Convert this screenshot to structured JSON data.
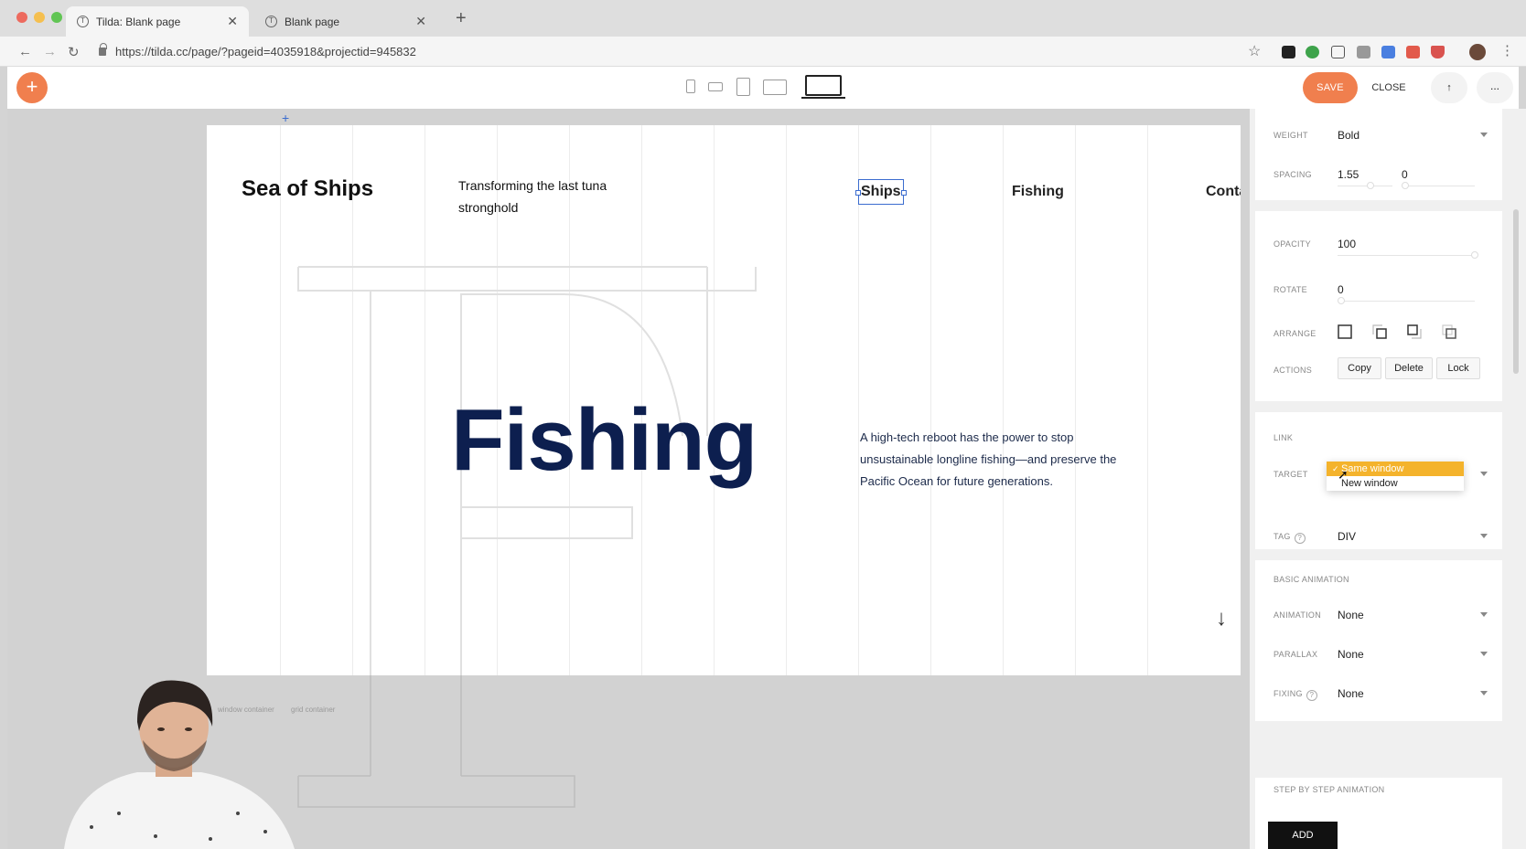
{
  "browser": {
    "tabs": [
      {
        "title": "Tilda: Blank page",
        "active": true
      },
      {
        "title": "Blank page",
        "active": false
      }
    ],
    "url": "https://tilda.cc/page/?pageid=4035918&projectid=945832"
  },
  "toolbar": {
    "save_label": "SAVE",
    "close_label": "CLOSE",
    "more_label": "...",
    "pin_label": "↑"
  },
  "canvas": {
    "logo": "Sea of Ships",
    "tagline": "Transforming the last tuna stronghold",
    "nav": [
      "Ships",
      "Fishing",
      "Conta"
    ],
    "hero_title": "Fishing",
    "description": "A high-tech reboot has the power to stop unsustainable longline fishing—and preserve the Pacific Ocean for future generations.",
    "labels": [
      "window container",
      "grid container"
    ]
  },
  "panel": {
    "weight": {
      "label": "WEIGHT",
      "value": "Bold"
    },
    "spacing": {
      "label": "SPACING",
      "line_height": "1.55",
      "letter_spacing": "0"
    },
    "opacity": {
      "label": "OPACITY",
      "value": "100"
    },
    "rotate": {
      "label": "ROTATE",
      "value": "0"
    },
    "arrange": {
      "label": "ARRANGE"
    },
    "actions": {
      "label": "ACTIONS",
      "buttons": [
        "Copy",
        "Delete",
        "Lock"
      ]
    },
    "link": {
      "label": "LINK"
    },
    "target": {
      "label": "TARGET",
      "options": [
        "Same window",
        "New window"
      ],
      "selected": "Same window"
    },
    "tag": {
      "label": "TAG",
      "value": "DIV"
    },
    "basic_animation": {
      "title": "BASIC ANIMATION"
    },
    "animation": {
      "label": "ANIMATION",
      "value": "None"
    },
    "parallax": {
      "label": "PARALLAX",
      "value": "None"
    },
    "fixing": {
      "label": "FIXING",
      "value": "None"
    },
    "step_animation": {
      "title": "STEP BY STEP ANIMATION",
      "add_label": "ADD"
    }
  },
  "colors": {
    "accent": "#f07f4e",
    "hero_text": "#0d1f4f",
    "selection": "#3b6ccf",
    "dropdown_selected": "#f4b32c"
  }
}
